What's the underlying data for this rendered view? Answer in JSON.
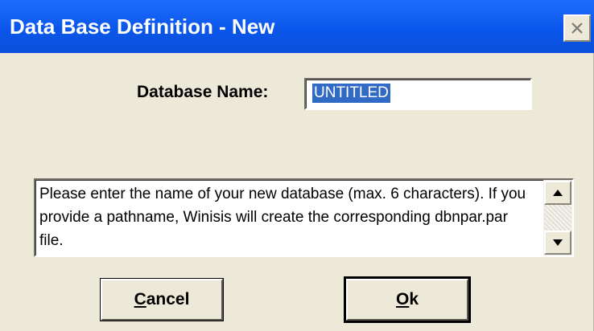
{
  "window": {
    "title": "Data Base Definition - New",
    "close_icon": "close-icon"
  },
  "form": {
    "name_label": "Database Name:",
    "name_value": "UNTITLED"
  },
  "help": {
    "text": "Please enter the name of your new database (max. 6 characters). If you provide a pathname, Winisis will create the corresponding dbnpar.par file."
  },
  "buttons": {
    "cancel_mnemonic": "C",
    "cancel_rest": "ancel",
    "ok_mnemonic": "O",
    "ok_rest": "k"
  },
  "colors": {
    "titlebar": "#0a56ea",
    "selection": "#316ac5",
    "face": "#ece9d8"
  }
}
